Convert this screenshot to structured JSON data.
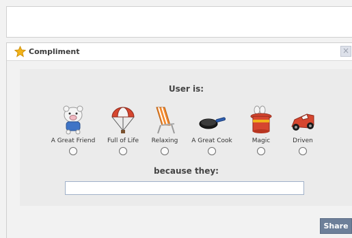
{
  "compose": {
    "value": ""
  },
  "dialog": {
    "title": "Compliment",
    "close_label": "×",
    "icon": "star-icon",
    "heading": "User is:",
    "because_heading": "because they:",
    "reason_value": "",
    "options": [
      {
        "label": "A Great Friend",
        "icon": "piglet-friend-icon",
        "selected": false
      },
      {
        "label": "Full of Life",
        "icon": "parachute-icon",
        "selected": false
      },
      {
        "label": "Relaxing",
        "icon": "beach-chair-icon",
        "selected": false
      },
      {
        "label": "A Great Cook",
        "icon": "frying-pan-icon",
        "selected": false
      },
      {
        "label": "Magic",
        "icon": "magic-hat-icon",
        "selected": false
      },
      {
        "label": "Driven",
        "icon": "race-car-icon",
        "selected": false
      }
    ]
  },
  "share_label": "Share",
  "colors": {
    "share_button": "#6d7f99",
    "star": "#f2b31a"
  }
}
